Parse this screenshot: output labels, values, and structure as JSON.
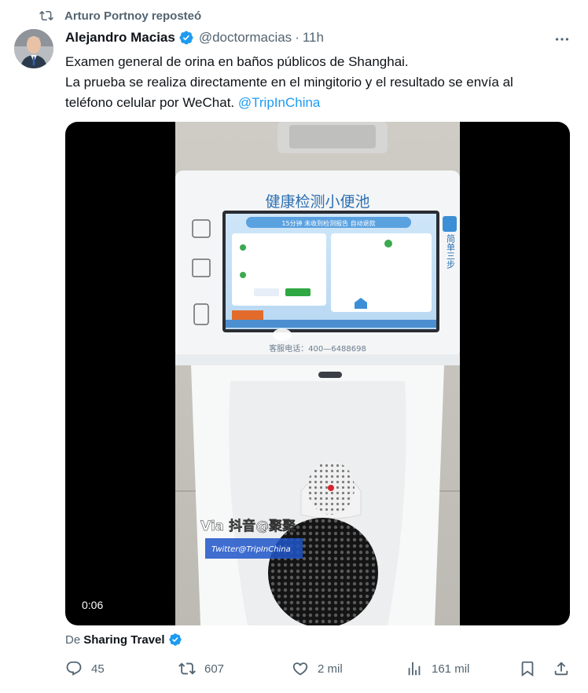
{
  "repost": {
    "text": "Arturo Portnoy reposteó",
    "icon": "repost-icon"
  },
  "author": {
    "name": "Alejandro Macias",
    "handle": "@doctormacias",
    "separator": "·",
    "time": "11h",
    "verified": true
  },
  "tweet": {
    "line1": "Examen general de orina en baños públicos de Shanghai.",
    "line2": "La prueba se realiza directamente en el mingitorio y el resultado se envía al",
    "line3_prefix": "teléfono celular por WeChat.",
    "mention": "@TripInChina"
  },
  "video": {
    "timestamp": "0:06",
    "screen_title": "健康检测小便池",
    "screen_banner": "15分钟 未收到检测报告 自动退款",
    "side_text": "简单三步",
    "phone": "客服电话：400—6488698",
    "watermark_via": "Via 抖音@聚聚",
    "watermark_twitter": "Twitter@TripInChina"
  },
  "source": {
    "from": "De",
    "name": "Sharing Travel"
  },
  "actions": {
    "replies": "45",
    "reposts": "607",
    "likes": "2 mil",
    "views": "161 mil"
  },
  "colors": {
    "accent": "#1d9bf0",
    "muted": "#536471",
    "text": "#0f1419"
  }
}
